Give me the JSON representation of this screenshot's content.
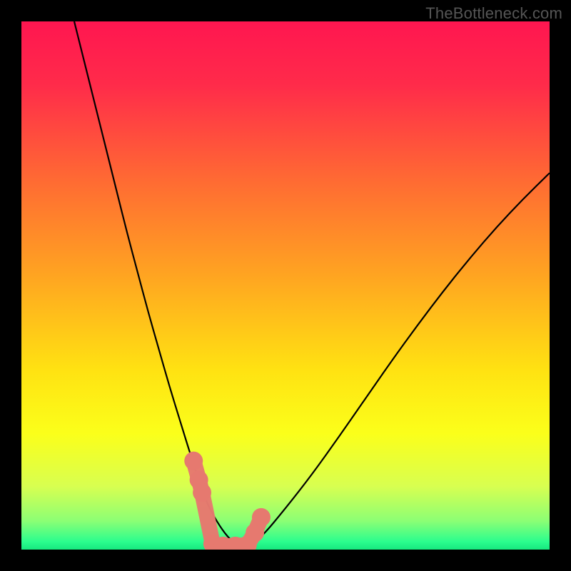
{
  "watermark": "TheBottleneck.com",
  "chart_data": {
    "type": "line",
    "title": "",
    "xlabel": "",
    "ylabel": "",
    "xlim": [
      0,
      100
    ],
    "ylim": [
      0,
      100
    ],
    "grid": false,
    "legend": false,
    "background_gradient": {
      "stops": [
        {
          "offset": 0,
          "color": "#ff1650"
        },
        {
          "offset": 0.12,
          "color": "#ff2b4a"
        },
        {
          "offset": 0.3,
          "color": "#ff6a33"
        },
        {
          "offset": 0.48,
          "color": "#ffa421"
        },
        {
          "offset": 0.66,
          "color": "#ffe212"
        },
        {
          "offset": 0.78,
          "color": "#fbff1a"
        },
        {
          "offset": 0.88,
          "color": "#d8ff50"
        },
        {
          "offset": 0.945,
          "color": "#8dff74"
        },
        {
          "offset": 0.985,
          "color": "#2bfd8e"
        },
        {
          "offset": 1.0,
          "color": "#17e87f"
        }
      ]
    },
    "series": [
      {
        "name": "curve",
        "stroke": "#000000",
        "stroke_width": 2.2,
        "x": [
          10,
          12,
          14,
          16,
          18,
          20,
          22,
          24,
          26,
          28,
          30,
          32,
          33.5,
          35,
          37,
          39,
          41,
          43,
          45.5,
          50,
          55,
          60,
          65,
          70,
          75,
          80,
          85,
          90,
          95,
          100
        ],
        "y": [
          100,
          92,
          84,
          76,
          68,
          60,
          52.5,
          45,
          38,
          31,
          24.5,
          18,
          13.5,
          9,
          5.3,
          2.4,
          0.7,
          0.7,
          2.4,
          7.8,
          14.2,
          21.2,
          28.4,
          35.6,
          42.5,
          49.1,
          55.3,
          61.1,
          66.4,
          71.3
        ]
      },
      {
        "name": "marker-cluster",
        "type": "scatter",
        "color": "#e6796f",
        "x": [
          32.6,
          33.6,
          34.2,
          36.2,
          38.2,
          40.5,
          42.8,
          44.2,
          45.4
        ],
        "y": [
          16.8,
          13.2,
          10.8,
          1.1,
          0.7,
          0.7,
          0.9,
          3.2,
          6.1
        ]
      }
    ]
  }
}
